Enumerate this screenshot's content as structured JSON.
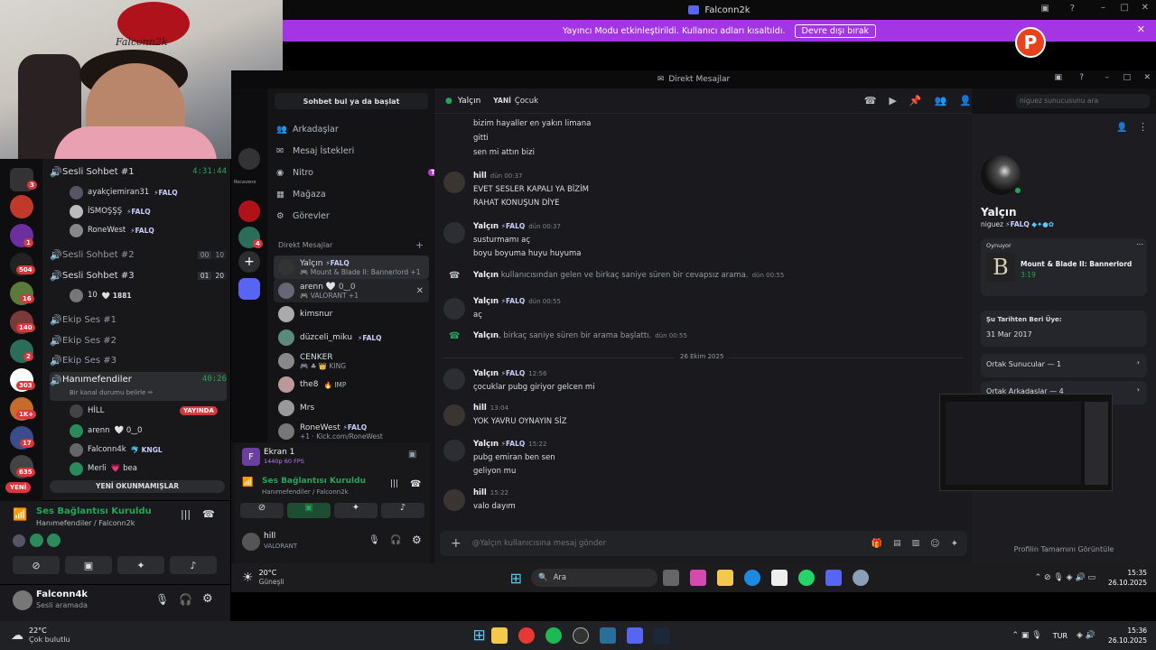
{
  "webcam": {
    "sign": "Falconn2k"
  },
  "outer_window": {
    "title": "Falconn2k"
  },
  "banner": {
    "text": "Yayıncı Modu etkinleştirildi. Kullanıcı adları kısaltıldı.",
    "button": "Devre dışı bırak"
  },
  "server_badges": [
    "3",
    "1",
    "504",
    "16",
    "140",
    "2",
    "303",
    "1K+",
    "17",
    "635"
  ],
  "server_new": "YENİ",
  "channels": {
    "sesli1": {
      "name": "Sesli Sohbet #1",
      "time": "4:31:44"
    },
    "sesli1_users": [
      {
        "name": "ayakçiemiran31",
        "tag": "⚡FALQ"
      },
      {
        "name": "İSMOŞŞŞ",
        "tag": "⚡FALQ"
      },
      {
        "name": "RoneWest",
        "tag": "⚡FALQ"
      }
    ],
    "sesli2": {
      "name": "Sesli Sohbet #2",
      "a": "00",
      "b": "10"
    },
    "sesli3": {
      "name": "Sesli Sohbet #3",
      "a": "01",
      "b": "20"
    },
    "sesli3_user": {
      "name": "10",
      "extra": "🤍 1881"
    },
    "ekip1": "Ekip Ses #1",
    "ekip2": "Ekip Ses #2",
    "ekip3": "Ekip Ses #3",
    "hanim": {
      "name": "Hanımefendiler",
      "time": "40:26",
      "status": "Bir kanal durumu belirle ✏"
    },
    "hanim_users": [
      {
        "name": "HİLL",
        "tag": "YAYINDA"
      },
      {
        "name": "arenn",
        "tag": "🤍 0‿0"
      },
      {
        "name": "Falconn4k",
        "tag": "🐬 KNGL"
      },
      {
        "name": "Merli",
        "tag": "💗 bea"
      }
    ],
    "unread": "YENİ OKUNMAMIŞLAR"
  },
  "voice_panel": {
    "title": "Ses Bağlantısı Kuruldu",
    "sub": "Hanımefendiler / Falconn2k"
  },
  "user_bar": {
    "name": "Falconn4k",
    "status": "Sesli aramada"
  },
  "inner_window": {
    "title": "Direkt Mesajlar"
  },
  "inner_guild": {
    "badge": "4",
    "label": "Rocaveno"
  },
  "inner_sidebar": {
    "search": "Sohbet bul ya da başlat",
    "nav": [
      {
        "label": "Arkadaşlar",
        "badge": "2"
      },
      {
        "label": "Mesaj İstekleri",
        "badge": "2"
      },
      {
        "label": "Nitro",
        "badge": "TEKLİF"
      },
      {
        "label": "Mağaza",
        "badge": ""
      },
      {
        "label": "Görevler",
        "badge": ""
      }
    ],
    "dm_header": "Direkt Mesajlar",
    "dms": [
      {
        "name": "Yalçın",
        "tag": "⚡FALQ",
        "sub": "🎮 Mount & Blade II: Bannerlord +1"
      },
      {
        "name": "arenn",
        "tag": "🤍 0‿0",
        "sub": "🎮 VALORANT +1"
      },
      {
        "name": "kimsnur",
        "tag": "",
        "sub": ""
      },
      {
        "name": "düzceli_miku",
        "tag": "⚡FALQ",
        "sub": ""
      },
      {
        "name": "CENKER",
        "tag": "",
        "sub": "🎮 ♣ 👑 KING"
      },
      {
        "name": "the8",
        "tag": "🔥 IMP",
        "sub": ""
      },
      {
        "name": "Mrs",
        "tag": "",
        "sub": ""
      },
      {
        "name": "RoneWest",
        "tag": "⚡FALQ",
        "sub": "+1 · Kick.com/RoneWest"
      }
    ],
    "stream": {
      "name": "Ekran 1",
      "sub": "1440p 60 FPS"
    },
    "voice": {
      "title": "Ses Bağlantısı Kuruldu",
      "sub": "Hanımefendiler / Falconn2k"
    },
    "user": {
      "name": "hill",
      "status": "VALORANT"
    }
  },
  "chat": {
    "header": {
      "name": "Yalçın",
      "tag1": "YANİ",
      "tag2": "Çocuk",
      "search": "niguez sunucusunu ara"
    },
    "lines_top": [
      "bizim hayaller en yakın limana",
      "gitti",
      "sen mi attın bizi"
    ],
    "m1": {
      "author": "hill",
      "ts": "dün 00:37",
      "lines": [
        "EVET SESLER KAPALI YA BİZİM",
        "RAHAT KONUŞUN DİYE"
      ]
    },
    "m2": {
      "author": "Yalçın",
      "tag": "⚡FALQ",
      "ts": "dün 00:37",
      "lines": [
        "susturmamı aç",
        "boyu boyuma huyu huyuma"
      ]
    },
    "sys1": {
      "author": "Yalçın",
      "text": " kullanıcısından gelen ve birkaç saniye süren bir cevapsız arama.",
      "ts": "dün 00:55"
    },
    "m3": {
      "author": "Yalçın",
      "tag": "⚡FALQ",
      "ts": "dün 00:55",
      "lines": [
        "aç"
      ]
    },
    "sys2": {
      "author": "Yalçın",
      "text": ", birkaç saniye süren bir arama başlattı.",
      "ts": "dün 00:55"
    },
    "divider": "26 Ekim 2025",
    "m4": {
      "author": "Yalçın",
      "tag": "⚡FALQ",
      "ts": "12:56",
      "lines": [
        "çocuklar pubg giriyor gelcen mi"
      ]
    },
    "m5": {
      "author": "hill",
      "ts": "13:04",
      "lines": [
        "YOK YAVRU OYNAYIN SİZ"
      ]
    },
    "m6": {
      "author": "Yalçın",
      "tag": "⚡FALQ",
      "ts": "15:22",
      "lines": [
        "pubg emiran ben sen",
        "geliyon mu"
      ]
    },
    "m7": {
      "author": "hill",
      "ts": "15:22",
      "lines": [
        "valo dayım"
      ]
    },
    "composer": "@Yalçın kullanıcısına mesaj gönder"
  },
  "profile": {
    "name": "Yalçın",
    "handle": "niguez",
    "tag": "⚡FALQ",
    "activity_label": "Oynuyor",
    "game": "Mount & Blade II: Bannerlord",
    "game_time": "3:19",
    "member_label": "Şu Tarihten Beri Üye:",
    "member_date": "31 Mar 2017",
    "servers": "Ortak Sunucular — 1",
    "friends": "Ortak Arkadaşlar — 4",
    "full": "Profilin Tamamını Görüntüle"
  },
  "inner_taskbar": {
    "temp": "20°C",
    "weather": "Güneşli",
    "search": "Ara",
    "time": "15:35",
    "date": "26.10.2025"
  },
  "outer_taskbar": {
    "temp": "22°C",
    "weather": "Çok bulutlu",
    "lang": "TUR",
    "time": "15:36",
    "date": "26.10.2025"
  }
}
